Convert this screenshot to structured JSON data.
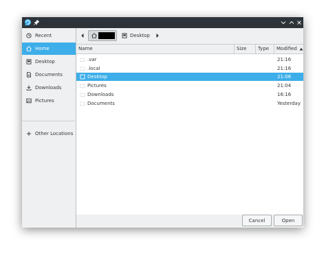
{
  "sidebar": {
    "items": [
      {
        "label": "Recent",
        "icon": "clock-icon"
      },
      {
        "label": "Home",
        "icon": "home-icon"
      },
      {
        "label": "Desktop",
        "icon": "desktop-icon"
      },
      {
        "label": "Documents",
        "icon": "document-icon"
      },
      {
        "label": "Downloads",
        "icon": "download-icon"
      },
      {
        "label": "Pictures",
        "icon": "picture-icon"
      }
    ],
    "other_locations": "Other Locations"
  },
  "pathbar": {
    "current": "Desktop"
  },
  "columns": {
    "name": "Name",
    "size": "Size",
    "type": "Type",
    "modified": "Modified"
  },
  "files": [
    {
      "name": ".var",
      "modified": "21:16"
    },
    {
      "name": ".local",
      "modified": "21:16"
    },
    {
      "name": "Desktop",
      "modified": "21:06",
      "selected": true
    },
    {
      "name": "Pictures",
      "modified": "21:04"
    },
    {
      "name": "Downloads",
      "modified": "16:16"
    },
    {
      "name": "Documents",
      "modified": "Yesterday"
    }
  ],
  "buttons": {
    "cancel": "Cancel",
    "open": "Open"
  },
  "colors": {
    "accent": "#3daee9",
    "titlebar": "#2c3339",
    "window_bg": "#eff0f1"
  }
}
